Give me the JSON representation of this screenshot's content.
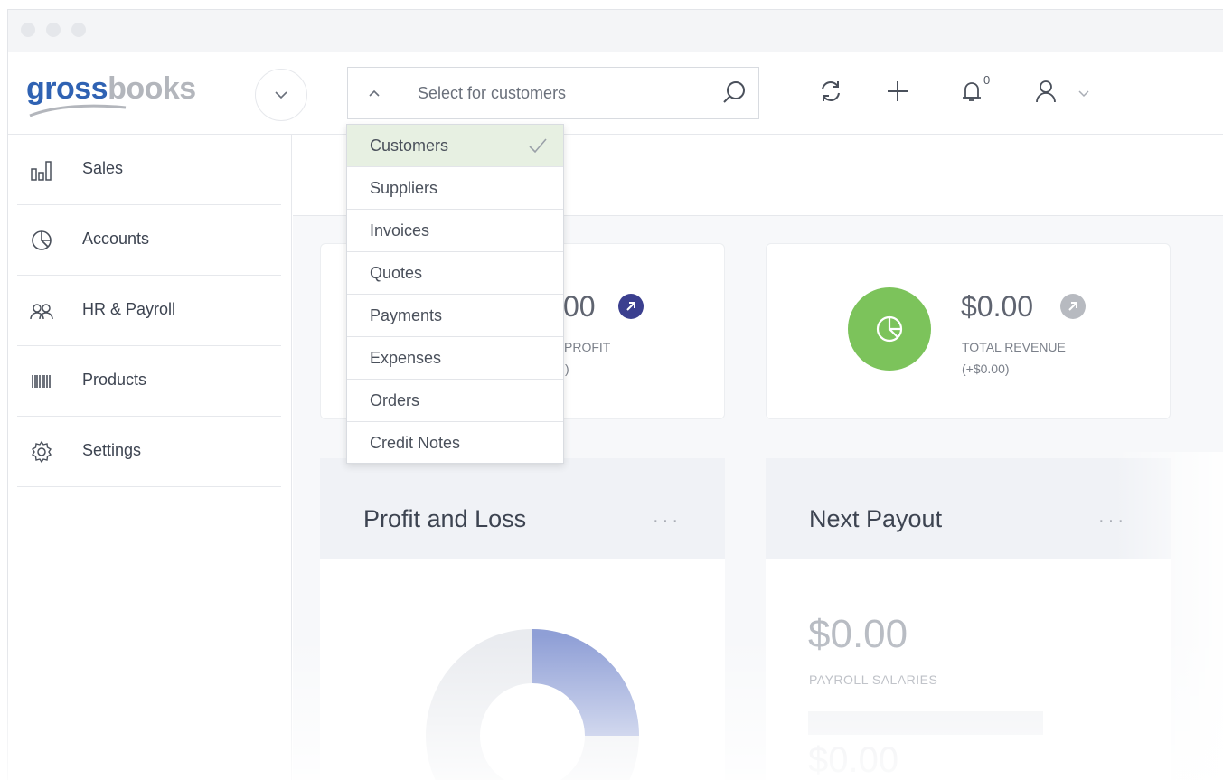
{
  "logo": {
    "part1": "gross",
    "part2": "books"
  },
  "search": {
    "placeholder": "Select for customers"
  },
  "notifications": {
    "count": "0"
  },
  "sidebar": {
    "items": [
      {
        "label": "Sales",
        "icon": "bar-chart-icon"
      },
      {
        "label": "Accounts",
        "icon": "pie-chart-icon"
      },
      {
        "label": "HR & Payroll",
        "icon": "people-icon"
      },
      {
        "label": "Products",
        "icon": "barcode-icon"
      },
      {
        "label": "Settings",
        "icon": "gear-icon"
      }
    ]
  },
  "dropdown": {
    "items": [
      {
        "label": "Customers",
        "selected": true
      },
      {
        "label": "Suppliers"
      },
      {
        "label": "Invoices"
      },
      {
        "label": "Quotes"
      },
      {
        "label": "Payments"
      },
      {
        "label": "Expenses"
      },
      {
        "label": "Orders"
      },
      {
        "label": "Credit Notes"
      }
    ]
  },
  "stats": {
    "profit": {
      "value_visible": "00",
      "label_visible": "PROFIT",
      "sub_visible": ")"
    },
    "revenue": {
      "value": "$0.00",
      "label": "TOTAL REVENUE",
      "sub": "(+$0.00)"
    }
  },
  "panels": {
    "profit_loss": {
      "title": "Profit and Loss",
      "menu": "···"
    },
    "next_payout": {
      "title": "Next Payout",
      "menu": "···",
      "value": "$0.00",
      "label": "PAYROLL SALARIES",
      "value2": "$0.00"
    }
  },
  "colors": {
    "brand_blue": "#2f62b3",
    "brand_gray": "#b3b6bc",
    "green": "#7cc35b",
    "navy": "#3b3f8f",
    "selected_bg": "#e7f0e2"
  }
}
